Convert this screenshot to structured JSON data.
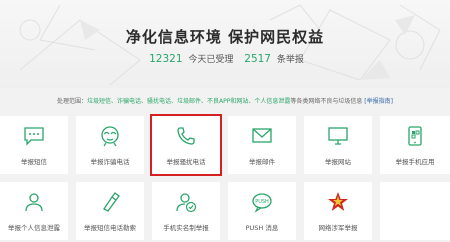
{
  "header": {
    "title": "净化信息环境 保护网民权益",
    "processed_count": "12321",
    "processed_label": "今天已受理",
    "report_count": "2517",
    "report_label": "条举报"
  },
  "scope": {
    "prefix": "处理范围：",
    "items": "垃圾短信、诈骗电话、骚扰电话、垃圾邮件、不良APP和网站、个人信息泄露",
    "suffix": "等各类网络不良与垃圾信息",
    "guide_link": "[举报指南]"
  },
  "tiles": [
    {
      "label": "举报短信",
      "icon": "chat-bubble-icon"
    },
    {
      "label": "举报诈骗电话",
      "icon": "fraud-mask-icon"
    },
    {
      "label": "举报骚扰电话",
      "icon": "phone-handset-icon"
    },
    {
      "label": "举报邮件",
      "icon": "envelope-icon"
    },
    {
      "label": "举报网站",
      "icon": "monitor-icon"
    },
    {
      "label": "举报手机应用",
      "icon": "mobile-app-icon"
    },
    {
      "label": "举报个人信息泄露",
      "icon": "person-id-icon"
    },
    {
      "label": "举报短信电话勒索",
      "icon": "extortion-icon"
    },
    {
      "label": "手机实名制举报",
      "icon": "user-check-icon"
    },
    {
      "label": "PUSH 消息",
      "icon": "push-bubble-icon"
    },
    {
      "label": "网络涉军举报",
      "icon": "military-star-icon"
    },
    {
      "label": "",
      "icon": "more-icon"
    }
  ],
  "colors": {
    "accent": "#2aa66a",
    "highlight_box": "#d42020",
    "title": "#2c2c2c"
  }
}
